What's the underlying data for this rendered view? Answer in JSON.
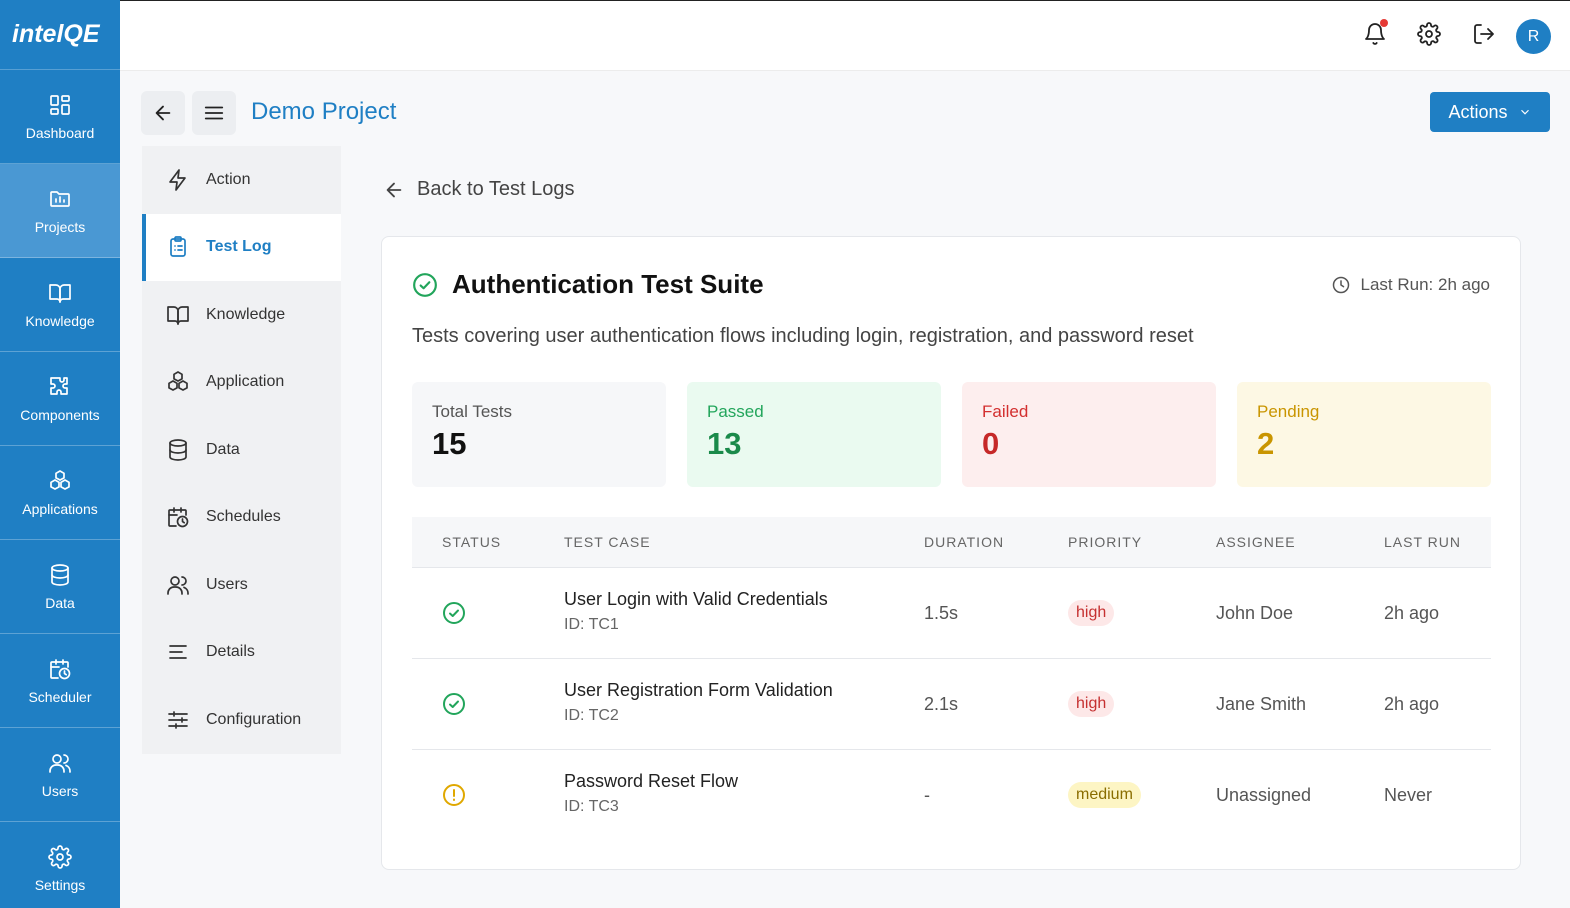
{
  "app": {
    "logo": "intelQE"
  },
  "rail": {
    "items": [
      {
        "label": "Dashboard",
        "icon": "dashboard-icon"
      },
      {
        "label": "Projects",
        "icon": "folder-icon"
      },
      {
        "label": "Knowledge",
        "icon": "book-icon"
      },
      {
        "label": "Components",
        "icon": "puzzle-icon"
      },
      {
        "label": "Applications",
        "icon": "boxes-icon"
      },
      {
        "label": "Data",
        "icon": "database-icon"
      },
      {
        "label": "Scheduler",
        "icon": "calendar-clock-icon"
      },
      {
        "label": "Users",
        "icon": "users-icon"
      },
      {
        "label": "Settings",
        "icon": "gear-icon"
      }
    ],
    "active_index": 1
  },
  "topbar": {
    "avatar_initial": "R",
    "has_notification": true
  },
  "header": {
    "project_title": "Demo Project",
    "actions_label": "Actions"
  },
  "subnav": {
    "items": [
      {
        "label": "Action",
        "icon": "bolt-icon"
      },
      {
        "label": "Test Log",
        "icon": "clipboard-icon"
      },
      {
        "label": "Knowledge",
        "icon": "book-icon"
      },
      {
        "label": "Application",
        "icon": "boxes-icon"
      },
      {
        "label": "Data",
        "icon": "database-icon"
      },
      {
        "label": "Schedules",
        "icon": "calendar-clock-icon"
      },
      {
        "label": "Users",
        "icon": "users-icon"
      },
      {
        "label": "Details",
        "icon": "lines-icon"
      },
      {
        "label": "Configuration",
        "icon": "sliders-icon"
      }
    ],
    "active_index": 1
  },
  "main": {
    "back_label": "Back to Test Logs",
    "suite_title": "Authentication Test Suite",
    "last_run": "Last Run: 2h ago",
    "description": "Tests covering user authentication flows including login, registration, and password reset",
    "stats": [
      {
        "label": "Total Tests",
        "value": "15",
        "bg": "#f6f7f9",
        "label_color": "#555555",
        "value_color": "#111111"
      },
      {
        "label": "Passed",
        "value": "13",
        "bg": "#eafaf0",
        "label_color": "#22a55b",
        "value_color": "#1a8a4a"
      },
      {
        "label": "Failed",
        "value": "0",
        "bg": "#fdeeee",
        "label_color": "#d32f2f",
        "value_color": "#c62828"
      },
      {
        "label": "Pending",
        "value": "2",
        "bg": "#fdf8e4",
        "label_color": "#c99500",
        "value_color": "#c99500"
      }
    ],
    "table": {
      "headers": [
        "STATUS",
        "TEST CASE",
        "DURATION",
        "PRIORITY",
        "ASSIGNEE",
        "LAST RUN"
      ],
      "rows": [
        {
          "status": "passed",
          "name": "User Login with Valid Credentials",
          "id": "ID: TC1",
          "duration": "1.5s",
          "priority": "high",
          "assignee": "John Doe",
          "last_run": "2h ago"
        },
        {
          "status": "passed",
          "name": "User Registration Form Validation",
          "id": "ID: TC2",
          "duration": "2.1s",
          "priority": "high",
          "assignee": "Jane Smith",
          "last_run": "2h ago"
        },
        {
          "status": "pending",
          "name": "Password Reset Flow",
          "id": "ID: TC3",
          "duration": "-",
          "priority": "medium",
          "assignee": "Unassigned",
          "last_run": "Never"
        }
      ]
    }
  },
  "colors": {
    "brand": "#1f7fc4",
    "success": "#22a55b",
    "warning": "#e0a800",
    "danger": "#d32f2f"
  }
}
